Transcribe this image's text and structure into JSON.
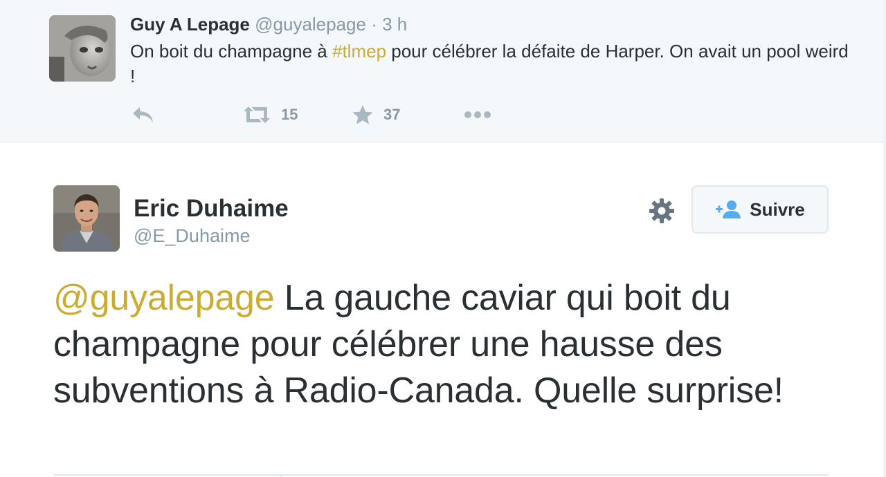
{
  "parent_tweet": {
    "author_name": "Guy A Lepage",
    "author_handle": "@guyalepage",
    "separator": "·",
    "timestamp": "3 h",
    "text_before": "On boit du champagne à ",
    "hashtag": "#tlmep",
    "text_after": " pour célébrer la défaite de Harper. On avait un pool weird !",
    "actions": {
      "reply_icon": "reply-icon",
      "retweet_icon": "retweet-icon",
      "retweet_count": "15",
      "favorite_icon": "star-icon",
      "favorite_count": "37",
      "more_icon": "more-icon"
    }
  },
  "main_tweet": {
    "author_name": "Eric Duhaime",
    "author_handle": "@E_Duhaime",
    "mention": "@guyalepage",
    "text": " La gauche caviar qui boit du champagne pour célébrer une hausse des subventions à Radio-Canada. Quelle surprise!",
    "settings_icon": "gear-icon",
    "follow_button": {
      "icon": "follow-user-icon",
      "label": "Suivre"
    }
  },
  "colors": {
    "link_accent": "#ccac30",
    "text_primary": "#292f33",
    "text_secondary": "#8899a6",
    "action_icon": "#aab8c2",
    "follow_icon": "#55acee",
    "parent_background": "#f5f8fa"
  }
}
